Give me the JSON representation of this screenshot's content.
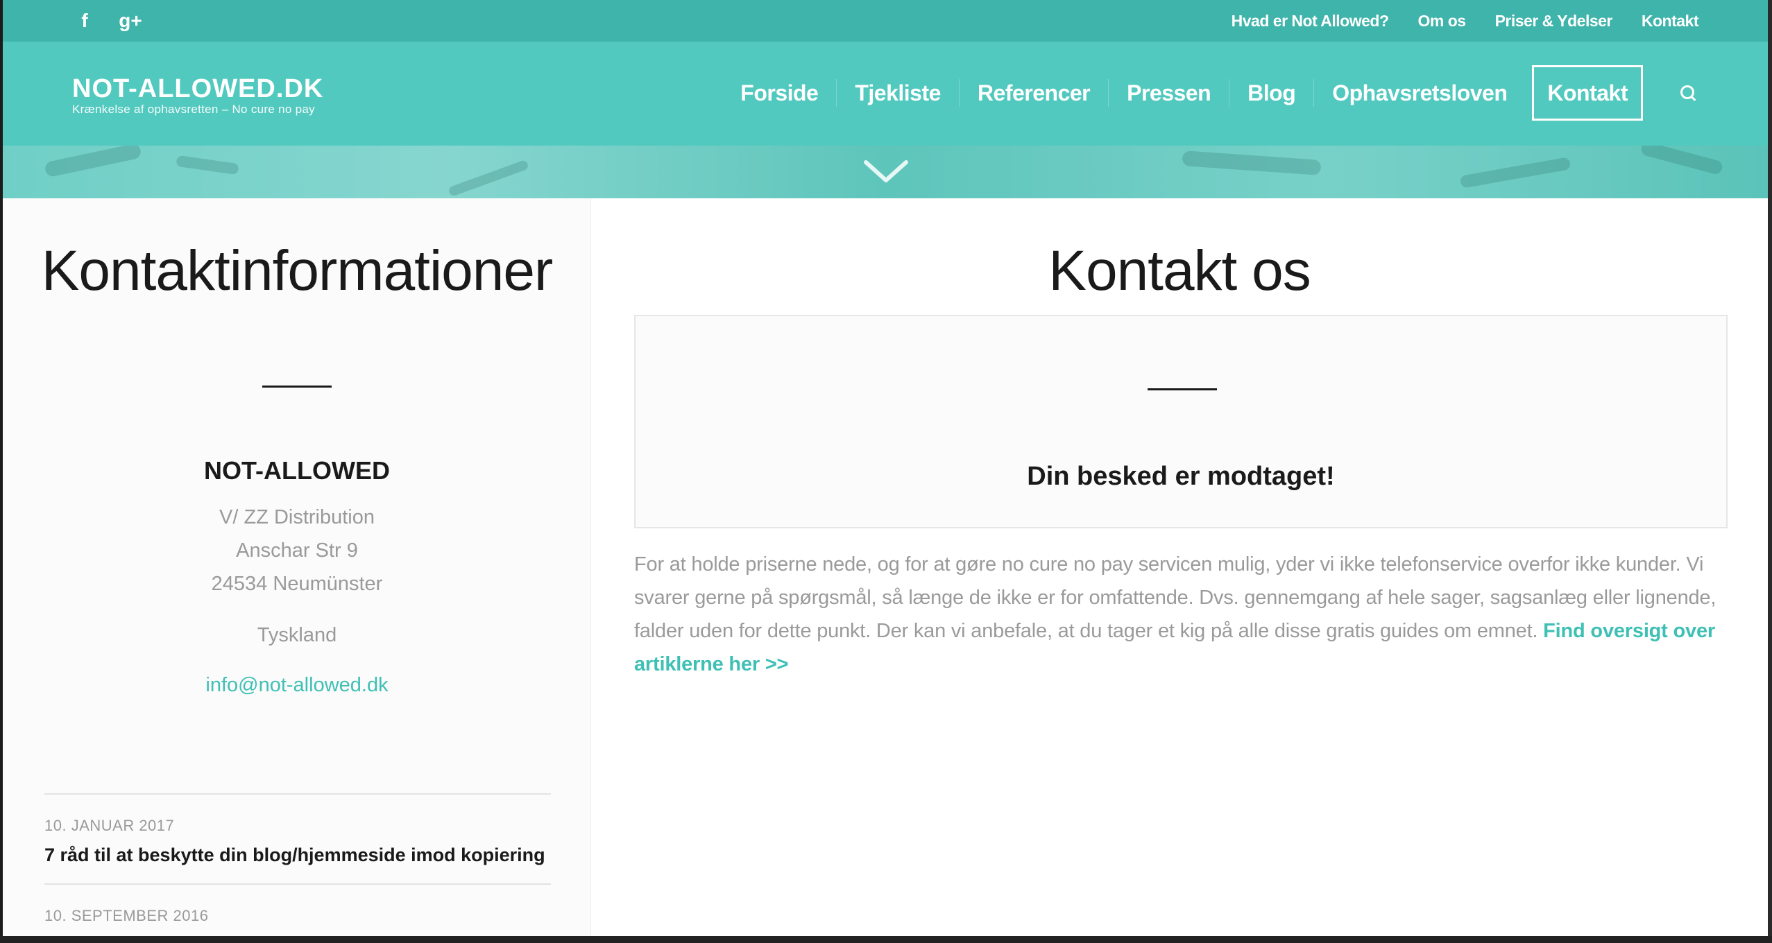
{
  "topbar": {
    "social": [
      {
        "icon": "facebook-icon",
        "glyph": "f"
      },
      {
        "icon": "google-plus-icon",
        "glyph": "g+"
      }
    ],
    "links": [
      "Hvad er Not Allowed?",
      "Om os",
      "Priser & Ydelser",
      "Kontakt"
    ]
  },
  "header": {
    "logo_name": "NOT-ALLOWED.DK",
    "logo_tagline": "Krænkelse af ophavsretten – No cure no pay",
    "nav": [
      "Forside",
      "Tjekliste",
      "Referencer",
      "Pressen",
      "Blog",
      "Ophavsretsloven",
      "Kontakt"
    ],
    "active_nav": "Kontakt"
  },
  "sidebar": {
    "title": "Kontaktinformationer",
    "company": "NOT-ALLOWED",
    "address_lines": [
      "V/ ZZ Distribution",
      "Anschar Str 9",
      "24534 Neumünster"
    ],
    "country": "Tyskland",
    "email": "info@not-allowed.dk",
    "posts": [
      {
        "date": "10. JANUAR 2017",
        "title": "7 råd til at beskytte din blog/hjemmeside imod kopiering"
      },
      {
        "date": "10. SEPTEMBER 2016",
        "title": ""
      }
    ]
  },
  "main": {
    "title": "Kontakt os",
    "confirmation": "Din besked er modtaget!",
    "body": "For at holde priserne nede, og for at gøre no cure no pay servicen mulig, yder vi ikke telefonservice overfor ikke kunder. Vi svarer gerne på spørgsmål, så længe de ikke er for omfattende. Dvs. gennemgang af hele sager, sagsanlæg eller lignende, falder uden for dette punkt. Der kan vi anbefale, at du tager et kig på alle disse gratis guides om emnet. ",
    "link": "Find oversigt over artiklerne her >>"
  },
  "colors": {
    "topbar": "#3fb4ab",
    "header": "#52c9bf",
    "accent_link": "#3fc0b5",
    "muted_text": "#9a9a9a"
  }
}
